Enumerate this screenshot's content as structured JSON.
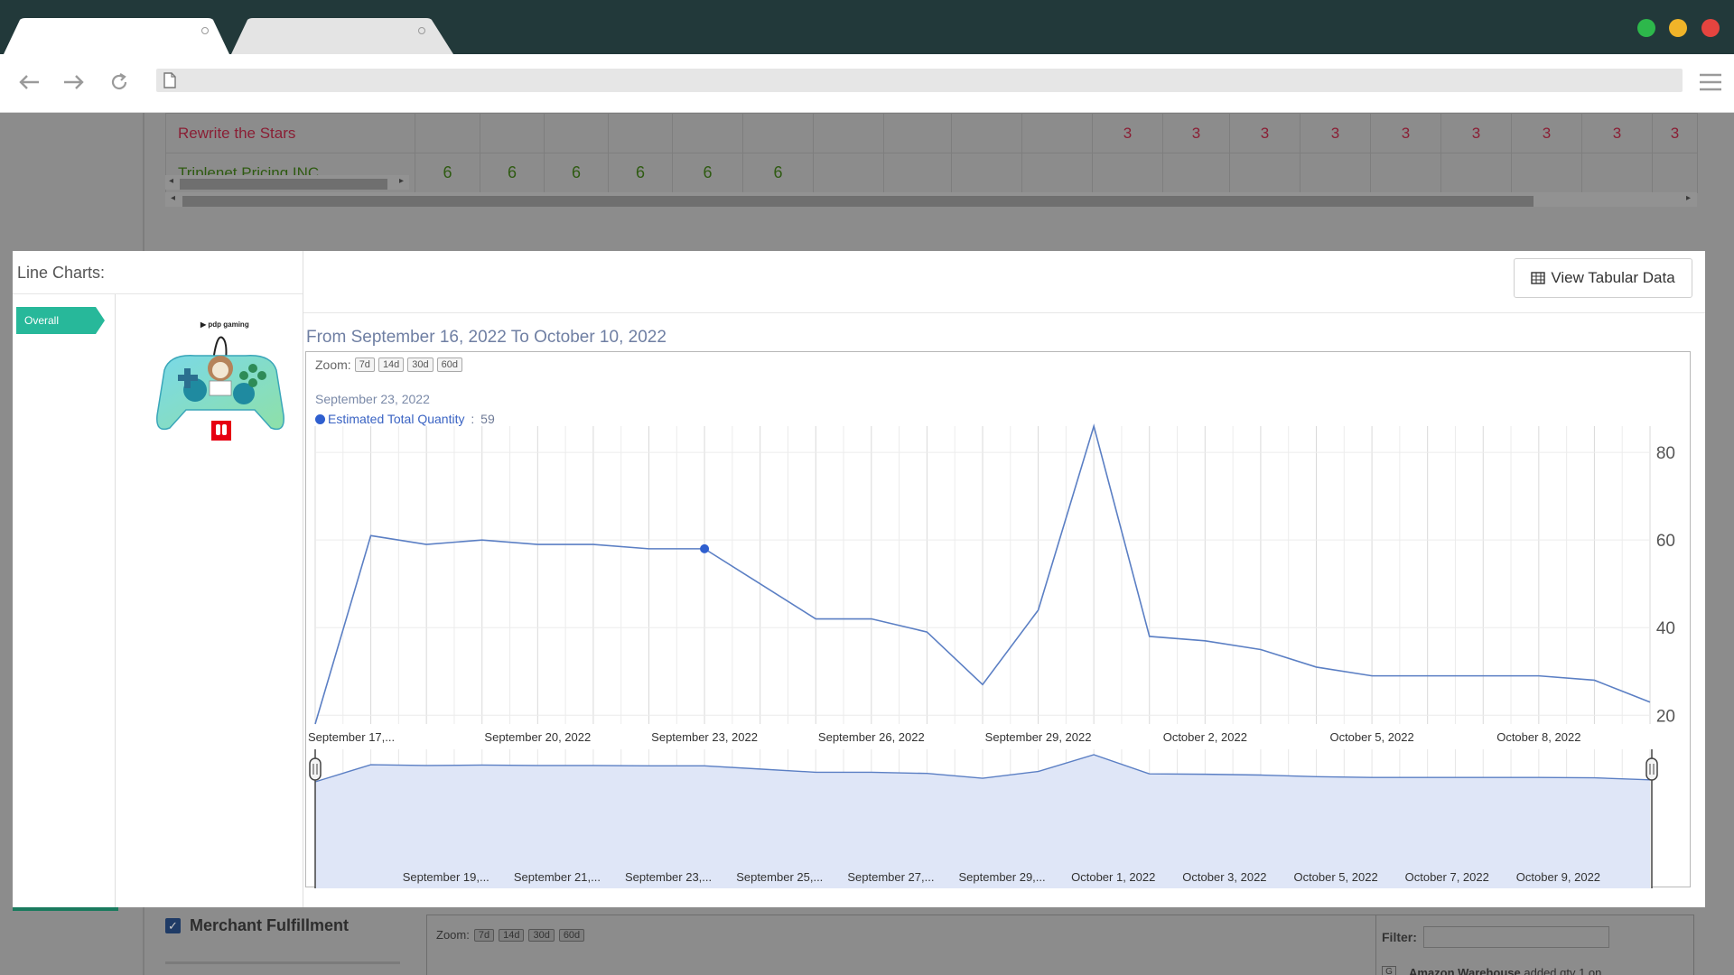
{
  "browser": {
    "address_value": "",
    "colors": {
      "titlebar": "#22393a",
      "dot_green": "#2db84b",
      "dot_yellow": "#f0b429",
      "dot_red": "#e5443f"
    }
  },
  "background_table": {
    "rows": [
      {
        "name": "Rewrite the Stars",
        "cells": [
          "",
          "",
          "",
          "",
          "",
          "",
          "",
          "",
          "",
          "",
          "3",
          "3",
          "3",
          "3",
          "3",
          "3",
          "3",
          "3",
          "3"
        ]
      },
      {
        "name": "Triplenet Pricing INC",
        "cells": [
          "6",
          "6",
          "6",
          "6",
          "6",
          "6",
          "",
          "",
          "",
          "",
          "",
          "",
          "",
          "",
          "",
          "",
          "",
          "",
          ""
        ]
      }
    ]
  },
  "modal": {
    "title": "Line Charts:",
    "tab_overall": "Overall",
    "view_button": "View Tabular Data",
    "date_range": "From September 16, 2022 To October 10, 2022",
    "product": {
      "brand": "pdp gaming",
      "badge": "Nintendo Switch"
    }
  },
  "zoom": {
    "label": "Zoom:",
    "buttons": [
      "7d",
      "14d",
      "30d",
      "60d"
    ]
  },
  "tooltip": {
    "date": "September 23, 2022",
    "series": "Estimated Total Quantity",
    "value": "59"
  },
  "chart_data": {
    "type": "line",
    "series": [
      {
        "name": "Estimated Total Quantity",
        "color": "#5b7fc4",
        "x": [
          "2022-09-16",
          "2022-09-17",
          "2022-09-18",
          "2022-09-19",
          "2022-09-20",
          "2022-09-21",
          "2022-09-22",
          "2022-09-23",
          "2022-09-24",
          "2022-09-25",
          "2022-09-26",
          "2022-09-27",
          "2022-09-28",
          "2022-09-29",
          "2022-09-30",
          "2022-10-01",
          "2022-10-02",
          "2022-10-03",
          "2022-10-04",
          "2022-10-05",
          "2022-10-06",
          "2022-10-07",
          "2022-10-08",
          "2022-10-09",
          "2022-10-10"
        ],
        "values": [
          18,
          61,
          59,
          60,
          59,
          59,
          58,
          58,
          50,
          42,
          42,
          39,
          27,
          44,
          86,
          38,
          37,
          35,
          31,
          29,
          29,
          29,
          29,
          28,
          23
        ]
      }
    ],
    "highlight_index": 7,
    "ylim": [
      18,
      86
    ],
    "y_ticks": [
      20,
      40,
      60,
      80
    ],
    "x_tick_labels": [
      "September 17,...",
      "September 20, 2022",
      "September 23, 2022",
      "September 26, 2022",
      "September 29, 2022",
      "October 2, 2022",
      "October 5, 2022",
      "October 8, 2022"
    ],
    "x_tick_indices": [
      1,
      4,
      7,
      10,
      13,
      16,
      19,
      22
    ],
    "navigator_tick_labels": [
      "September 19,...",
      "September 21,...",
      "September 23,...",
      "September 25,...",
      "September 27,...",
      "September 29,...",
      "October 1, 2022",
      "October 3, 2022",
      "October 5, 2022",
      "October 7, 2022",
      "October 9, 2022"
    ],
    "navigator_tick_indices": [
      3,
      5,
      7,
      9,
      11,
      13,
      15,
      17,
      19,
      21,
      23
    ],
    "grid": true,
    "legend": "none"
  },
  "bottom": {
    "merchant_label": "Merchant Fulfillment",
    "zoom_label": "Zoom:",
    "zoom_buttons": [
      "7d",
      "14d",
      "30d",
      "60d"
    ],
    "filter_label": "Filter:",
    "filter_value": "",
    "note_bold": "Amazon Warehouse",
    "note_rest": " added qty 1 on"
  }
}
